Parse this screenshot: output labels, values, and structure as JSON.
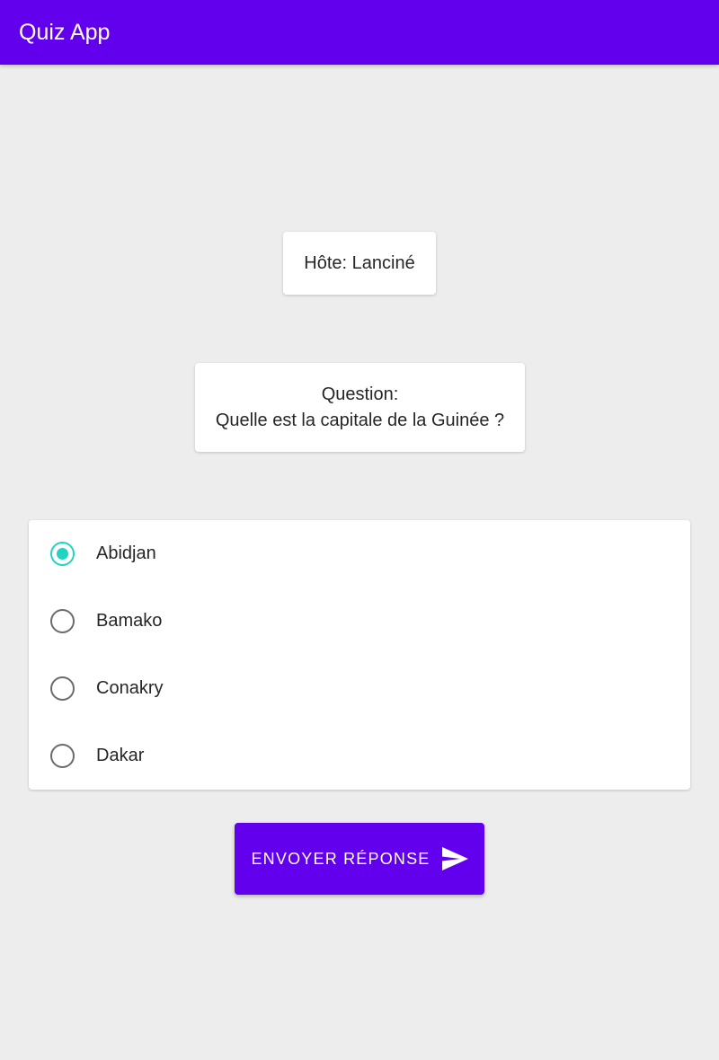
{
  "app_bar": {
    "title": "Quiz App",
    "color": "#6200EE"
  },
  "host": {
    "text": "Hôte: Lanciné"
  },
  "question": {
    "label": "Question:",
    "text": "Quelle est la capitale de la Guinée ?"
  },
  "options": {
    "selected": "Abidjan",
    "accent_color": "#1ED6C0",
    "items": [
      {
        "label": "Abidjan",
        "checked": true
      },
      {
        "label": "Bamako",
        "checked": false
      },
      {
        "label": "Conakry",
        "checked": false
      },
      {
        "label": "Dakar",
        "checked": false
      }
    ]
  },
  "submit": {
    "label": "ENVOYER RÉPONSE",
    "icon": "send-icon"
  }
}
